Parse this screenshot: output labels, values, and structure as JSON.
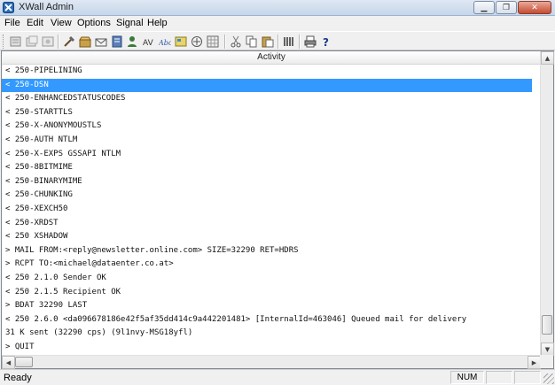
{
  "window": {
    "title": "XWall Admin",
    "minimize_glyph": "▁",
    "maximize_glyph": "❐",
    "close_glyph": "✕"
  },
  "menu": [
    "File",
    "Edit",
    "View",
    "Options",
    "Signal",
    "Help"
  ],
  "toolbar": {
    "icons": [
      "properties-icon",
      "copy-settings-icon",
      "settings-icon",
      "tools-icon",
      "archive-icon",
      "mail-queue-icon",
      "server-icon",
      "add-user-icon",
      "statistics-icon",
      "spam-icon",
      "virus-icon",
      "filter-icon",
      "address-book-icon",
      "network-icon",
      "cut-icon",
      "copy-icon",
      "paste-icon",
      "columns-icon",
      "print-icon",
      "help-icon"
    ]
  },
  "activity": {
    "column_header": "Activity",
    "selected_index": 1,
    "lines": [
      "< 250-PIPELINING",
      "< 250-DSN",
      "< 250-ENHANCEDSTATUSCODES",
      "< 250-STARTTLS",
      "< 250-X-ANONYMOUSTLS",
      "< 250-AUTH NTLM",
      "< 250-X-EXPS GSSAPI NTLM",
      "< 250-8BITMIME",
      "< 250-BINARYMIME",
      "< 250-CHUNKING",
      "< 250-XEXCH50",
      "< 250-XRDST",
      "< 250 XSHADOW",
      "> MAIL FROM:<reply@newsletter.online.com> SIZE=32290 RET=HDRS",
      "> RCPT TO:<michael@dataenter.co.at>",
      "< 250 2.1.0 Sender OK",
      "< 250 2.1.5 Recipient OK",
      "> BDAT 32290 LAST",
      "< 250 2.6.0 <da096678186e42f5af35dd414c9a442201481> [InternalId=463046] Queued mail for delivery",
      "31 K sent (32290 cps) (9l1nvy-MSG18yfl)",
      "> QUIT"
    ]
  },
  "scrollbar": {
    "up": "▲",
    "down": "▼",
    "left": "◀",
    "right": "▶",
    "vertical_position": 0.97,
    "horizontal_position": 0.0
  },
  "status": {
    "text": "Ready",
    "num": "NUM"
  },
  "colors": {
    "selection": "#3399ff",
    "window_bg": "#f0f0f0"
  }
}
